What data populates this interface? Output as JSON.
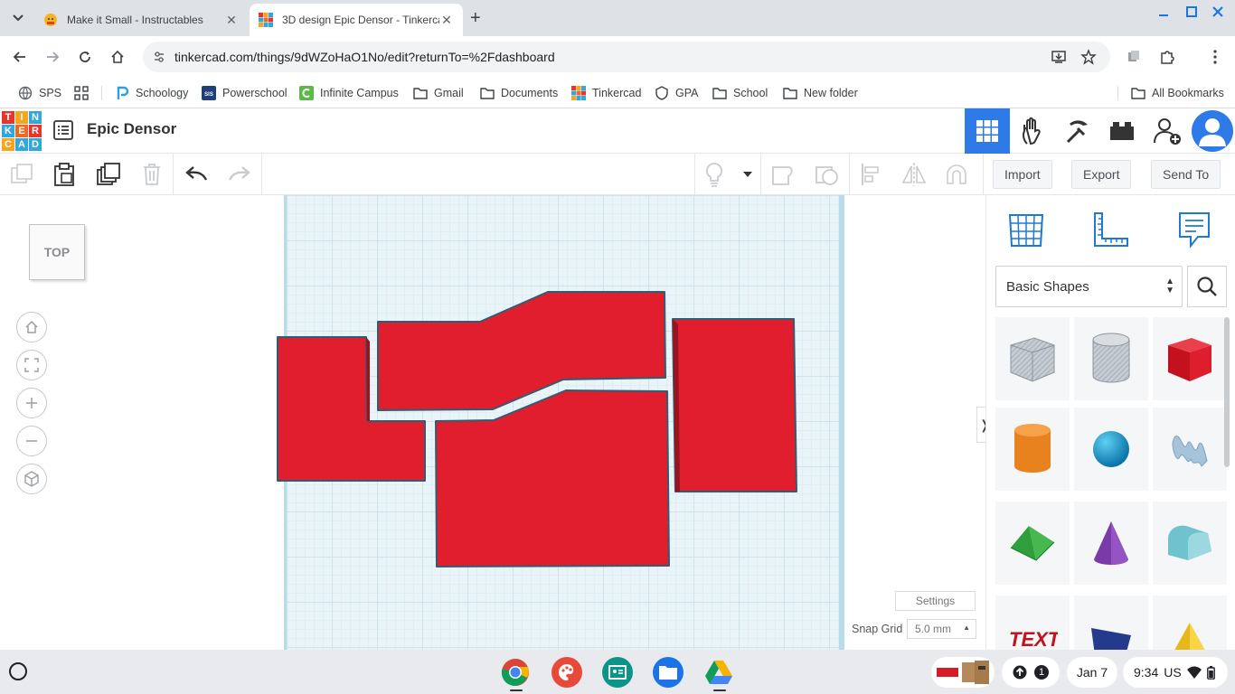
{
  "browser": {
    "tabs": [
      {
        "title": "Make it Small - Instructables",
        "active": false
      },
      {
        "title": "3D design Epic Densor - Tinkercad",
        "active": true
      }
    ],
    "url": "tinkercad.com/things/9dWZoHaO1No/edit?returnTo=%2Fdashboard",
    "bookmarks": [
      {
        "label": "SPS",
        "icon": "globe-icon"
      },
      {
        "label": "",
        "icon": "apps-grid-icon"
      },
      {
        "label": "Schoology",
        "icon": "schoology-icon"
      },
      {
        "label": "Powerschool",
        "icon": "sis-icon"
      },
      {
        "label": "Infinite Campus",
        "icon": "campus-icon"
      },
      {
        "label": "Gmail",
        "icon": "folder-icon"
      },
      {
        "label": "Documents",
        "icon": "folder-icon"
      },
      {
        "label": "Tinkercad",
        "icon": "tinkercad-icon"
      },
      {
        "label": "GPA",
        "icon": "shield-icon"
      },
      {
        "label": "School",
        "icon": "folder-icon"
      },
      {
        "label": "New folder",
        "icon": "folder-icon"
      }
    ],
    "all_bookmarks": "All Bookmarks"
  },
  "app": {
    "logo_letters": [
      "T",
      "I",
      "N",
      "K",
      "E",
      "R",
      "C",
      "A",
      "D"
    ],
    "logo_colors": [
      "#e6352d",
      "#f7a51b",
      "#2fa8e0",
      "#2fa8e0",
      "#ec6a24",
      "#e6352d",
      "#f7a51b",
      "#2fa8e0",
      "#2fa8e0"
    ],
    "design_name": "Epic Densor",
    "accent": "#2e7ae6"
  },
  "edit_toolbar": {
    "import_label": "Import",
    "export_label": "Export",
    "send_to_label": "Send To"
  },
  "workplane": {
    "view_cube_label": "TOP",
    "settings_label": "Settings",
    "snap_grid_label": "Snap Grid",
    "snap_grid_value": "5.0 mm",
    "shape_color": "#e01e2d",
    "shape_edge_color": "#2f5d74"
  },
  "panel": {
    "category": "Basic Shapes",
    "shapes": [
      "box-hole-shape",
      "cylinder-hole-shape",
      "box-shape",
      "cylinder-shape",
      "sphere-shape",
      "scribble-shape",
      "roof-shape",
      "cone-shape",
      "round-roof-shape",
      "text-shape",
      "wedge-shape",
      "pyramid-shape"
    ]
  },
  "shelf": {
    "date": "Jan 7",
    "time": "9:34",
    "locale": "US",
    "notification_count": "1"
  }
}
